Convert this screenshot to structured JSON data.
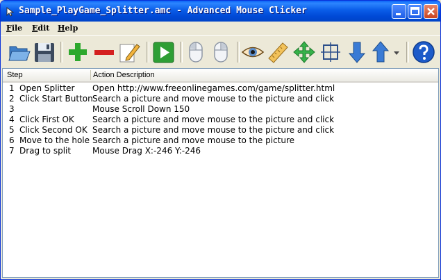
{
  "window": {
    "title": "Sample_PlayGame_Splitter.amc - Advanced Mouse Clicker"
  },
  "menu": {
    "items": [
      "File",
      "Edit",
      "Help"
    ]
  },
  "toolbar": {
    "buttons": [
      {
        "name": "open-folder-icon"
      },
      {
        "name": "save-disk-icon"
      },
      {
        "name": "add-plus-icon"
      },
      {
        "name": "delete-minus-icon"
      },
      {
        "name": "edit-pencil-icon"
      },
      {
        "name": "play-icon"
      },
      {
        "name": "mouse-left-click-icon"
      },
      {
        "name": "mouse-right-click-icon"
      },
      {
        "name": "eye-icon"
      },
      {
        "name": "ruler-icon"
      },
      {
        "name": "move-arrows-icon"
      },
      {
        "name": "crop-frame-icon"
      },
      {
        "name": "arrow-down-icon"
      },
      {
        "name": "arrow-up-icon"
      },
      {
        "name": "dropdown-chevron-icon"
      },
      {
        "name": "help-icon"
      }
    ],
    "colors": {
      "green": "#2DA82D",
      "red": "#D42020",
      "blue_arrow": "#3A7BD5",
      "help_blue": "#1D5BC9"
    }
  },
  "list": {
    "columns": [
      "Step",
      "Action Description"
    ],
    "rows": [
      {
        "num": "1",
        "step": "Open Splitter",
        "desc": "Open http://www.freeonlinegames.com/game/splitter.html"
      },
      {
        "num": "2",
        "step": "Click Start Button",
        "desc": "Search a picture and move mouse to the picture and click"
      },
      {
        "num": "3",
        "step": "",
        "desc": "Mouse Scroll Down 150"
      },
      {
        "num": "4",
        "step": "Click First OK",
        "desc": "Search a picture and move mouse to the picture and click"
      },
      {
        "num": "5",
        "step": "Click Second OK",
        "desc": "Search a picture and move mouse to the picture and click"
      },
      {
        "num": "6",
        "step": "Move to the hole",
        "desc": "Search a picture and move mouse to the picture"
      },
      {
        "num": "7",
        "step": "Drag to split",
        "desc": "Mouse Drag X:-246 Y:-246"
      }
    ]
  }
}
